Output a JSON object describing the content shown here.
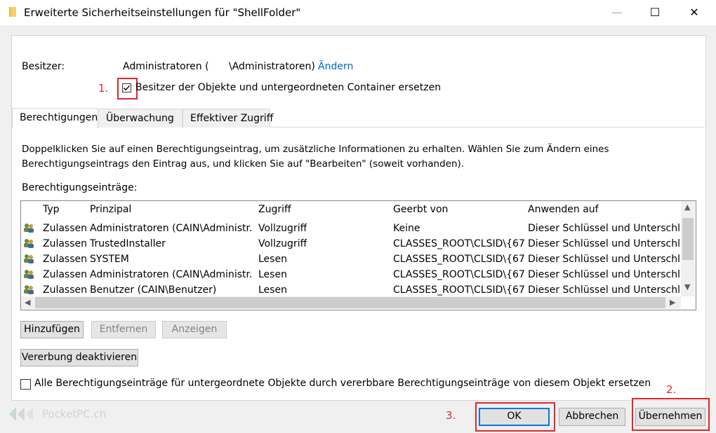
{
  "window": {
    "title": "Erweiterte Sicherheitseinstellungen für \"ShellFolder\"",
    "minimize_glyph": "—",
    "maximize_glyph": "☐",
    "close_glyph": "✕"
  },
  "owner": {
    "label": "Besitzer:",
    "value_part1": "Administratoren (",
    "value_part2": "\\Administratoren)",
    "change_link": "Ändern",
    "replace_checkbox_label": "Besitzer der Objekte und untergeordneten Container ersetzen",
    "replace_checked": true
  },
  "annotations": {
    "step1": "1.",
    "step2": "2.",
    "step3": "3.",
    "highlight_color": "#e0262c"
  },
  "tabs": [
    {
      "label": "Berechtigungen",
      "active": true
    },
    {
      "label": "Überwachung",
      "active": false
    },
    {
      "label": "Effektiver Zugriff",
      "active": false
    }
  ],
  "permissions": {
    "description_line1": "Doppelklicken Sie auf einen Berechtigungseintrag, um zusätzliche Informationen zu erhalten. Wählen Sie zum Ändern eines",
    "description_line2": "Berechtigungseintrags den Eintrag aus, und klicken Sie auf \"Bearbeiten\" (soweit vorhanden).",
    "entries_label": "Berechtigungseinträge:",
    "columns": [
      "Typ",
      "Prinzipal",
      "Zugriff",
      "Geerbt von",
      "Anwenden auf"
    ],
    "rows": [
      {
        "type": "Zulassen",
        "principal": "Administratoren (CAIN\\Administr...",
        "access": "Vollzugriff",
        "inherited": "Keine",
        "applies": "Dieser Schlüssel und Unterschlüs"
      },
      {
        "type": "Zulassen",
        "principal": "TrustedInstaller",
        "access": "Vollzugriff",
        "inherited": "CLASSES_ROOT\\CLSID\\{67...",
        "applies": "Dieser Schlüssel und Unterschlüs"
      },
      {
        "type": "Zulassen",
        "principal": "SYSTEM",
        "access": "Lesen",
        "inherited": "CLASSES_ROOT\\CLSID\\{67...",
        "applies": "Dieser Schlüssel und Unterschlüs"
      },
      {
        "type": "Zulassen",
        "principal": "Administratoren (CAIN\\Administr...",
        "access": "Lesen",
        "inherited": "CLASSES_ROOT\\CLSID\\{67...",
        "applies": "Dieser Schlüssel und Unterschlüs"
      },
      {
        "type": "Zulassen",
        "principal": "Benutzer (CAIN\\Benutzer)",
        "access": "Lesen",
        "inherited": "CLASSES_ROOT\\CLSID\\{67...",
        "applies": "Dieser Schlüssel und Unterschlüs"
      }
    ],
    "add_button": "Hinzufügen",
    "remove_button": "Entfernen",
    "view_button": "Anzeigen",
    "disable_inheritance_button": "Vererbung deaktivieren",
    "replace_child_checkbox_label": "Alle Berechtigungseinträge für untergeordnete Objekte durch vererbbare Berechtigungseinträge von diesem Objekt ersetzen",
    "replace_child_checked": false
  },
  "footer": {
    "ok_button": "OK",
    "cancel_button": "Abbrechen",
    "apply_button": "Übernehmen"
  },
  "watermark": "PocketPC.ch"
}
